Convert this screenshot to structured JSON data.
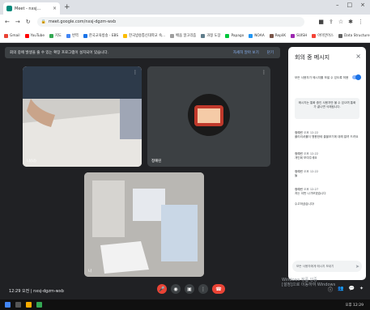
{
  "browser": {
    "tab_title": "Meet - nxsj...",
    "url": "meet.google.com/nxsj-dgzm-wxb",
    "window_controls": [
      "–",
      "□",
      "×"
    ],
    "bookmarks": [
      {
        "label": "Gmail",
        "color": "#ea4335"
      },
      {
        "label": "YouTube",
        "color": "#ff0000"
      },
      {
        "label": "지도",
        "color": "#34a853"
      },
      {
        "label": "번역",
        "color": "#4285f4"
      },
      {
        "label": "한국교육방송 - EBS",
        "color": "#1a73e8"
      },
      {
        "label": "한국방송통신대학교 숙...",
        "color": "#fbbc05"
      },
      {
        "label": "배움 알고리즘",
        "color": "#9e9e9e"
      },
      {
        "label": "과정 도장",
        "color": "#607d8b"
      },
      {
        "label": "Papago",
        "color": "#00c73c"
      },
      {
        "label": "NOAA",
        "color": "#2196f3"
      },
      {
        "label": "RepliK",
        "color": "#795548"
      },
      {
        "label": "SUISH",
        "color": "#9c27b0"
      },
      {
        "label": "아이언어스",
        "color": "#f44336"
      },
      {
        "label": "Data Structure an...",
        "color": "#616161"
      }
    ]
  },
  "notice": {
    "text": "회의 중에 발생을 줄 수 있는 확장 프로그램이 설치되어 있습니다.",
    "more_label": "자세히 알아 보기",
    "close_label": "닫기"
  },
  "tiles": [
    {
      "name": "나(나)"
    },
    {
      "name": "정예린"
    },
    {
      "name": "나"
    }
  ],
  "panel": {
    "title": "회의 중 메시지",
    "toggle_label": "모든 사용자가 메시지를 보낼 수 있도록 허용",
    "info": "메시지는 통화 중인 사용자만 볼 수 있으며 통화가 끝나면 삭제됩니다.",
    "messages": [
      {
        "who": "정예린",
        "time": "오후 12:22",
        "text": "플리리셔폴더 맹용한테 클을보기에 대해 알려 드려요"
      },
      {
        "who": "정예린",
        "time": "오후 12:22",
        "text": "개인회 보여주세요"
      },
      {
        "who": "정예린",
        "time": "오후 12:22",
        "text": "둘"
      },
      {
        "who": "정예린",
        "time": "오후 12:27",
        "text": "저는 이번 나가보겠습니다"
      },
      {
        "who": "",
        "time": "",
        "text": "수고하셨습니다!"
      }
    ],
    "input_placeholder": "모든 사용자에게 메시지 보내기"
  },
  "bottom": {
    "meeting_time": "12:29 오전",
    "meeting_code": "nxsj-dgzm-wxb",
    "watermark_line1": "Windows 정품 인증",
    "watermark_line2": "[설정]으로 이동하여 Windows"
  },
  "taskbar": {
    "clock": "오후 12:29"
  }
}
